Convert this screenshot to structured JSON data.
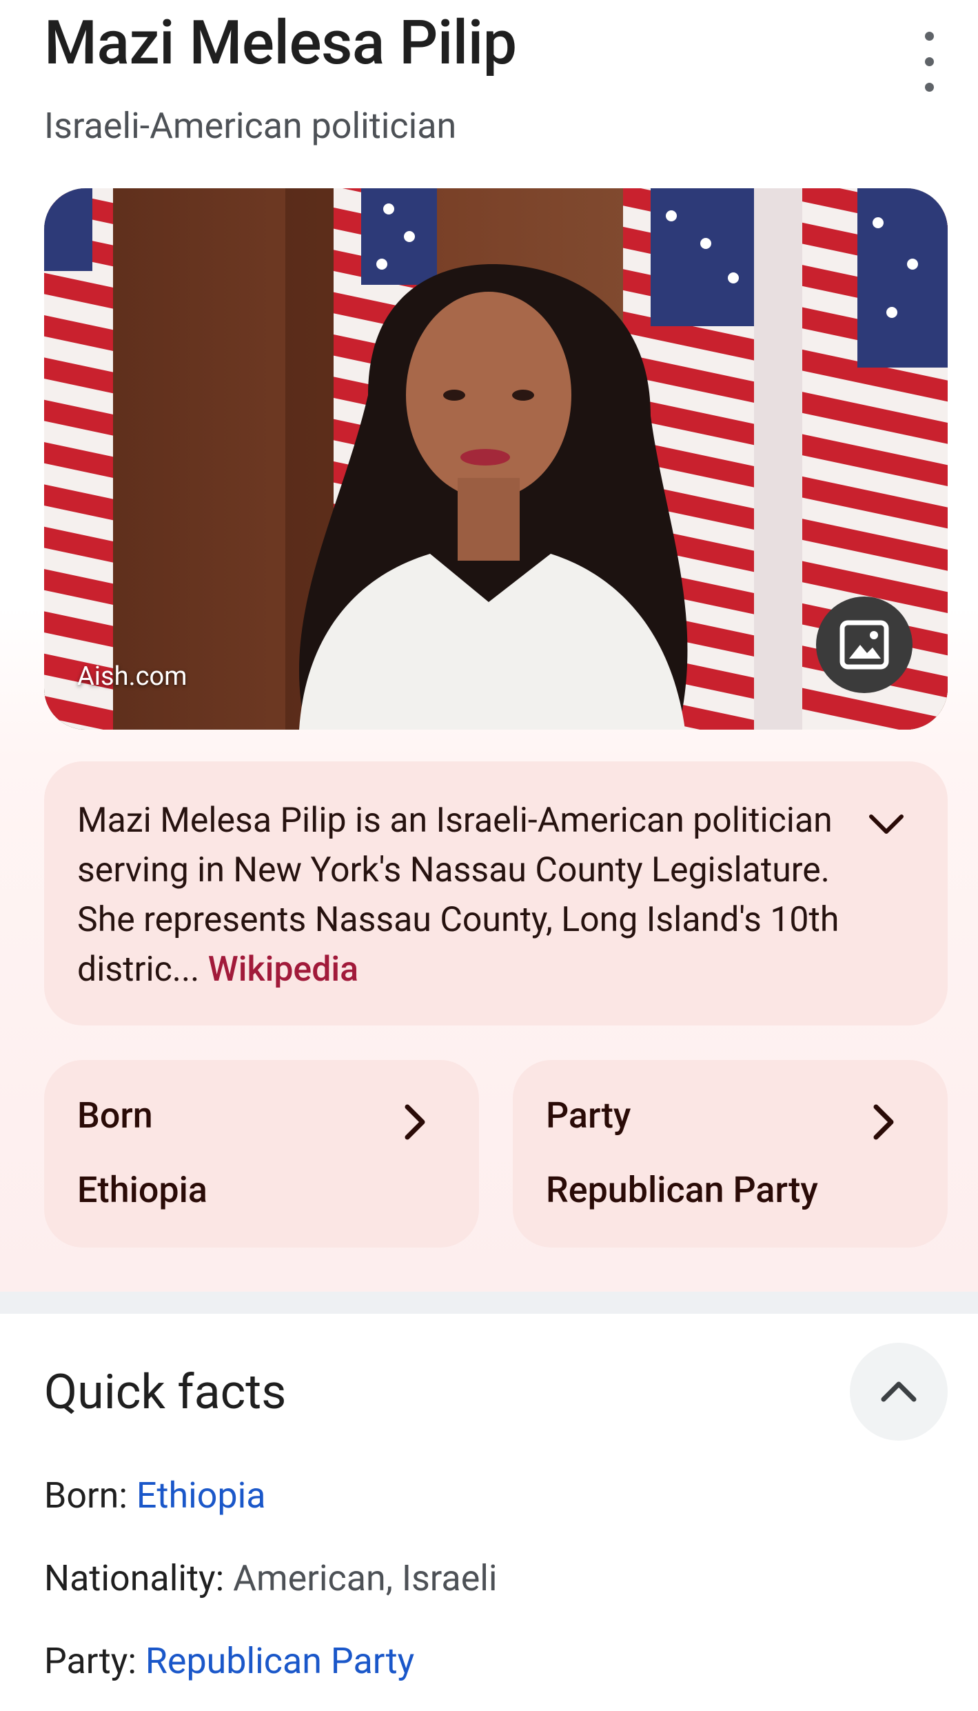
{
  "header": {
    "title": "Mazi Melesa Pilip",
    "subtitle": "Israeli-American politician"
  },
  "image": {
    "source": "Aish.com"
  },
  "description": {
    "text": "Mazi Melesa Pilip is an Israeli-American politician serving in New York's Nassau County Legislature. She represents Nassau County, Long Island's 10th distric...",
    "link_label": "Wikipedia"
  },
  "cards": [
    {
      "label": "Born",
      "value": "Ethiopia"
    },
    {
      "label": "Party",
      "value": "Republican Party"
    }
  ],
  "quick_facts": {
    "title": "Quick facts",
    "items": [
      {
        "key": "Born",
        "value": "Ethiopia",
        "is_link": true
      },
      {
        "key": "Nationality",
        "value": "American, Israeli",
        "is_link": false
      },
      {
        "key": "Party",
        "value": "Republican Party",
        "is_link": true
      }
    ]
  },
  "icons": {
    "more": "kebab-menu-icon",
    "image_gallery": "image-icon",
    "expand": "chevron-down-icon",
    "card_arrow": "chevron-right-icon",
    "collapse": "chevron-up-icon"
  },
  "colors": {
    "accent_link": "#a11a3a",
    "fact_link": "#1a57c9",
    "card_bg": "#fbe6e4"
  }
}
